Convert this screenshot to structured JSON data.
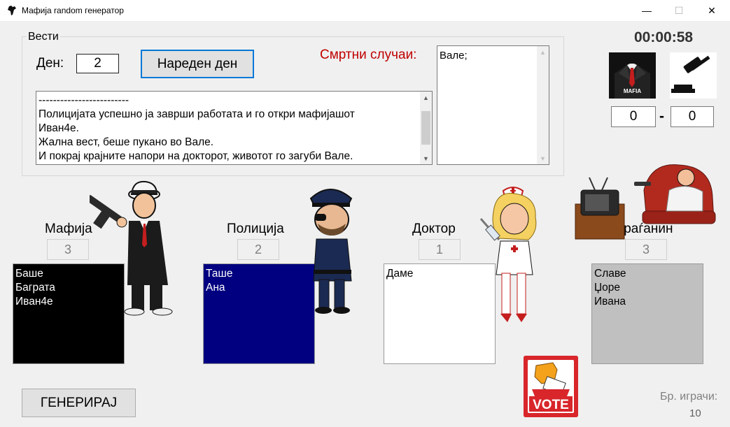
{
  "window": {
    "title": "Мафија random генератор",
    "controls": {
      "minimize": "—",
      "maximize": "☐",
      "close": "✕"
    }
  },
  "news": {
    "legend": "Вести",
    "day_label": "Ден:",
    "day_value": "2",
    "next_day_button": "Нареден ден",
    "deaths_label": "Смртни случаи:",
    "deaths_text": "Вале;",
    "log_lines": [
      "-------------------------",
      "Полицијата успешно ја заврши работата и го откри мафијашот",
      "Иван4е.",
      "Жална вест, беше пукано во Вале.",
      "И покрај крајните напори на докторот, животот го загуби Вале."
    ]
  },
  "timer": "00:00:58",
  "score": {
    "mafia_card_text": "MAFIA",
    "left": "0",
    "separator": "-",
    "right": "0"
  },
  "roles": [
    {
      "label": "Мафија",
      "count": "3",
      "players": [
        "Баше",
        "Баграта",
        "Иван4е"
      ],
      "box_bg": "#000000",
      "text_color": "#ffffff"
    },
    {
      "label": "Полиција",
      "count": "2",
      "players": [
        "Таше",
        "Ана"
      ],
      "box_bg": "#000080",
      "text_color": "#ffffff"
    },
    {
      "label": "Доктор",
      "count": "1",
      "players": [
        "Даме"
      ],
      "box_bg": "#ffffff",
      "text_color": "#000000"
    },
    {
      "label": "Граѓанин",
      "count": "3",
      "players": [
        "Славе",
        "Џоре",
        "Ивана"
      ],
      "box_bg": "#c0c0c0",
      "text_color": "#000000"
    }
  ],
  "generate_button": "ГЕНЕРИРАЈ",
  "vote_button": "VOTE",
  "players": {
    "label": "Бр. играчи:",
    "count": "10"
  },
  "colors": {
    "accent": "#0078d7",
    "deaths_label": "#c00000",
    "vote_red": "#d8262b"
  }
}
